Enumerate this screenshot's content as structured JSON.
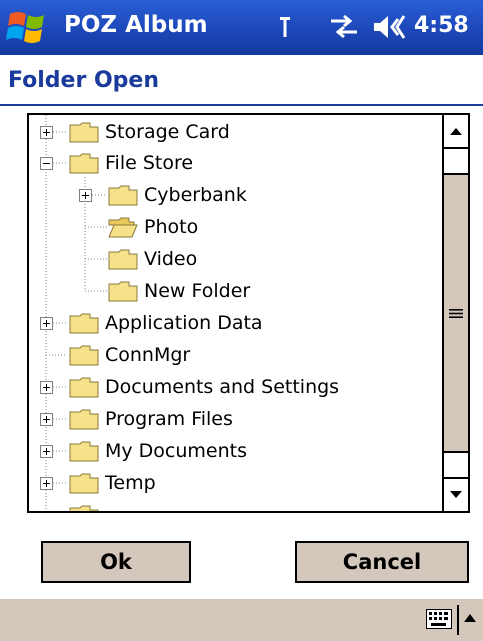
{
  "titlebar": {
    "app_title": "POZ Album",
    "time": "4:58"
  },
  "dialog": {
    "heading": "Folder Open"
  },
  "tree": {
    "items": [
      {
        "label": "Storage Card"
      },
      {
        "label": "File Store"
      },
      {
        "label": "Cyberbank"
      },
      {
        "label": "Photo"
      },
      {
        "label": "Video"
      },
      {
        "label": "New Folder"
      },
      {
        "label": "Application Data"
      },
      {
        "label": "ConnMgr"
      },
      {
        "label": "Documents and Settings"
      },
      {
        "label": "Program Files"
      },
      {
        "label": "My Documents"
      },
      {
        "label": "Temp"
      }
    ]
  },
  "buttons": {
    "ok_label": "Ok",
    "cancel_label": "Cancel"
  },
  "colors": {
    "titlebar": "#1c47b8",
    "heading": "#1a3a9c",
    "chrome": "#d4c8bd",
    "folder": "#f7e08a"
  },
  "icons": [
    "windows-start-icon",
    "signal-antenna-icon",
    "connectivity-icon",
    "volume-icon",
    "folder-icon",
    "open-folder-icon",
    "keyboard-icon"
  ]
}
